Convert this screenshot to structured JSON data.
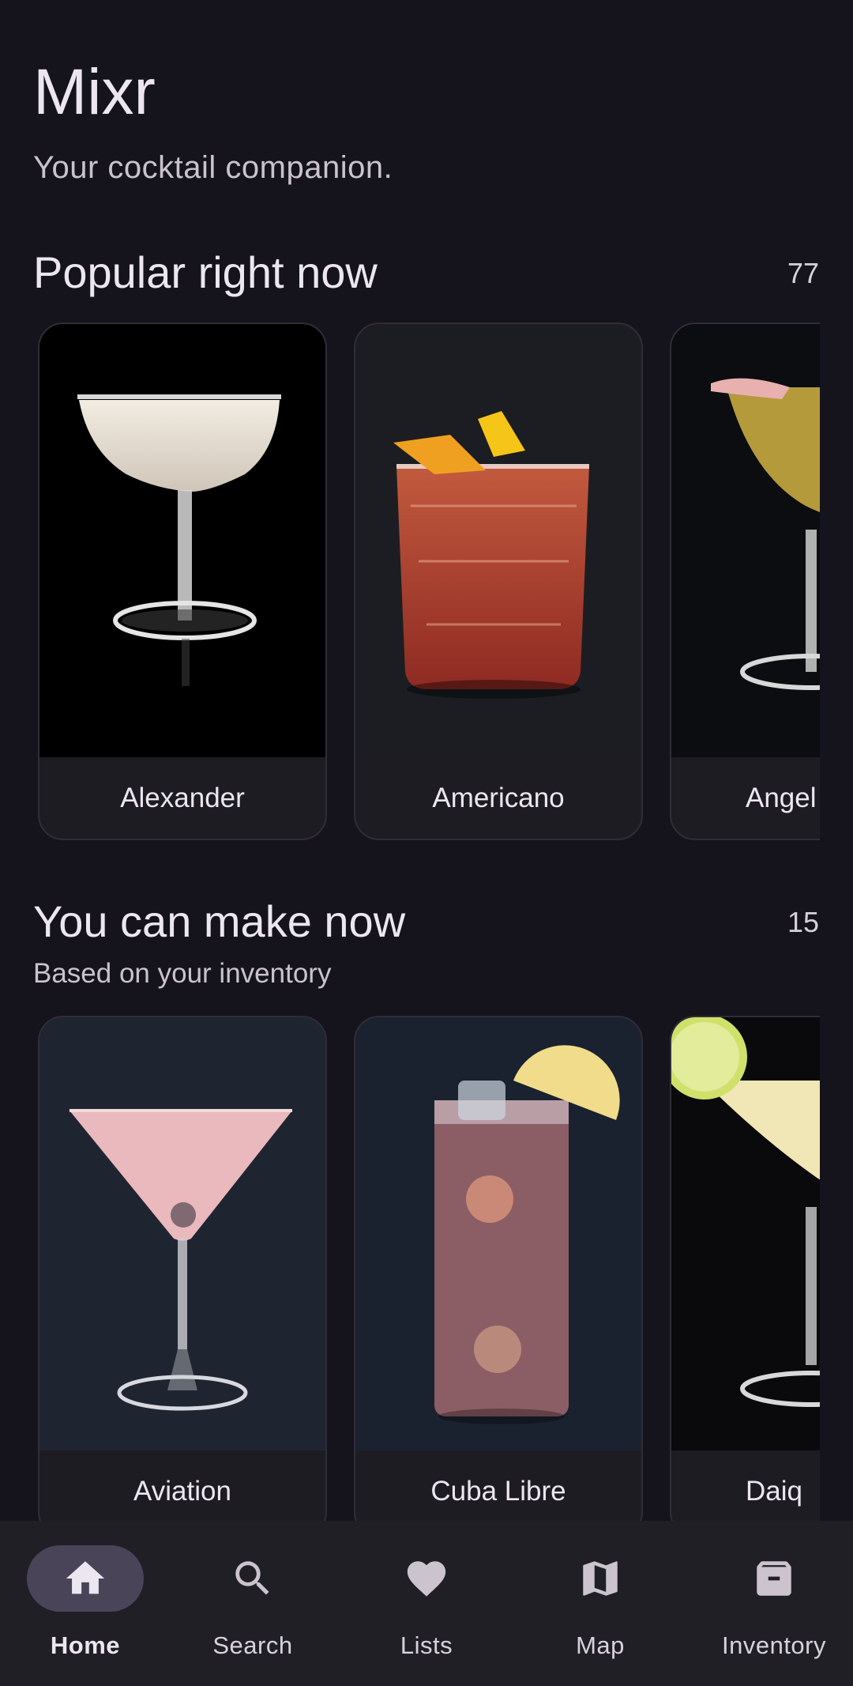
{
  "app": {
    "title": "Mixr",
    "subtitle": "Your cocktail companion."
  },
  "popular": {
    "title": "Popular right now",
    "count": "77",
    "cards": [
      {
        "name": "Alexander"
      },
      {
        "name": "Americano"
      },
      {
        "name": "Angel"
      }
    ]
  },
  "makeable": {
    "title": "You can make now",
    "subtitle": "Based on your inventory",
    "count": "15",
    "cards": [
      {
        "name": "Aviation"
      },
      {
        "name": "Cuba Libre"
      },
      {
        "name": "Daiq"
      }
    ]
  },
  "nav": {
    "items": [
      {
        "label": "Home",
        "icon": "home-icon",
        "active": true
      },
      {
        "label": "Search",
        "icon": "search-icon",
        "active": false
      },
      {
        "label": "Lists",
        "icon": "heart-icon",
        "active": false
      },
      {
        "label": "Map",
        "icon": "map-icon",
        "active": false
      },
      {
        "label": "Inventory",
        "icon": "archive-icon",
        "active": false
      }
    ]
  },
  "colors": {
    "background": "#15131b",
    "nav_background": "#211f26",
    "active_pill": "#4a4458"
  }
}
